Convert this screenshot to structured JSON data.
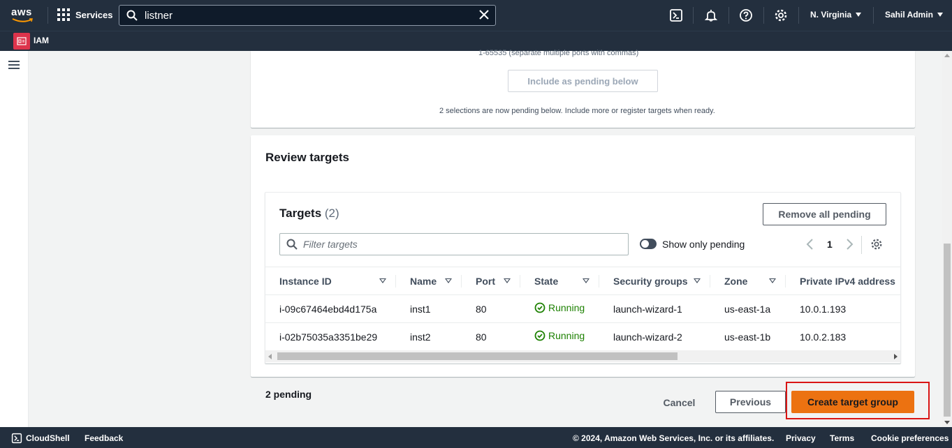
{
  "topnav": {
    "logo_text": "aws",
    "services_label": "Services",
    "search_value": "listner",
    "region_label": "N. Virginia",
    "user_label": "Sahil Admin",
    "icons": [
      "cloudshell-icon",
      "bell-icon",
      "help-icon",
      "gear-icon"
    ]
  },
  "subnav": {
    "service_label": "IAM",
    "service_icon_color": "#dd344c"
  },
  "previous_section": {
    "ports_hint": "1-65535 (separate multiple ports with commas)",
    "include_button": "Include as pending below",
    "pending_note": "2 selections are now pending below. Include more or register targets when ready."
  },
  "review": {
    "title": "Review targets",
    "targets_title": "Targets",
    "targets_count": "(2)",
    "remove_button": "Remove all pending",
    "filter_placeholder": "Filter targets",
    "toggle_label": "Show only pending",
    "page_number": "1",
    "columns": [
      "Instance ID",
      "Name",
      "Port",
      "State",
      "Security groups",
      "Zone",
      "Private IPv4 address"
    ],
    "rows": [
      {
        "instance_id": "i-09c67464ebd4d175a",
        "name": "inst1",
        "port": "80",
        "state": "Running",
        "security_group": "launch-wizard-1",
        "zone": "us-east-1a",
        "ip": "10.0.1.193"
      },
      {
        "instance_id": "i-02b75035a3351be29",
        "name": "inst2",
        "port": "80",
        "state": "Running",
        "security_group": "launch-wizard-2",
        "zone": "us-east-1b",
        "ip": "10.0.2.183"
      }
    ]
  },
  "actions": {
    "pending_count": "2 pending",
    "cancel": "Cancel",
    "previous": "Previous",
    "create": "Create target group"
  },
  "footer": {
    "cloudshell": "CloudShell",
    "feedback": "Feedback",
    "copyright": "© 2024, Amazon Web Services, Inc. or its affiliates.",
    "privacy": "Privacy",
    "terms": "Terms",
    "cookies": "Cookie preferences"
  },
  "colors": {
    "nav_bg": "#232f3e",
    "primary_button": "#ec7211",
    "running_status": "#1d8102",
    "highlight_border": "#d91515"
  }
}
